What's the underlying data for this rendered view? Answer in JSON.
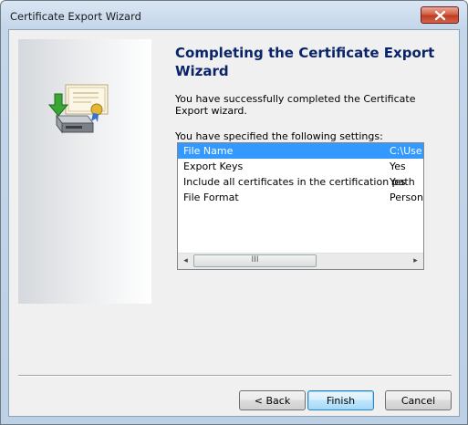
{
  "window": {
    "title": "Certificate Export Wizard",
    "close_icon": "close-icon"
  },
  "page": {
    "heading": "Completing the Certificate Export Wizard",
    "description": "You have successfully completed the Certificate Export wizard.",
    "settings_label": "You have specified the following settings:"
  },
  "settings": {
    "rows": [
      {
        "name": "File Name",
        "value": "C:\\Use"
      },
      {
        "name": "Export Keys",
        "value": "Yes"
      },
      {
        "name": "Include all certificates in the certification path",
        "value": "Yes"
      },
      {
        "name": "File Format",
        "value": "Persona"
      }
    ],
    "scroll_left": "◂",
    "scroll_right": "▸",
    "thumb_grip": "III"
  },
  "buttons": {
    "back": "< Back",
    "finish": "Finish",
    "cancel": "Cancel"
  },
  "colors": {
    "selection": "#3399ff",
    "heading": "#0a246a"
  }
}
